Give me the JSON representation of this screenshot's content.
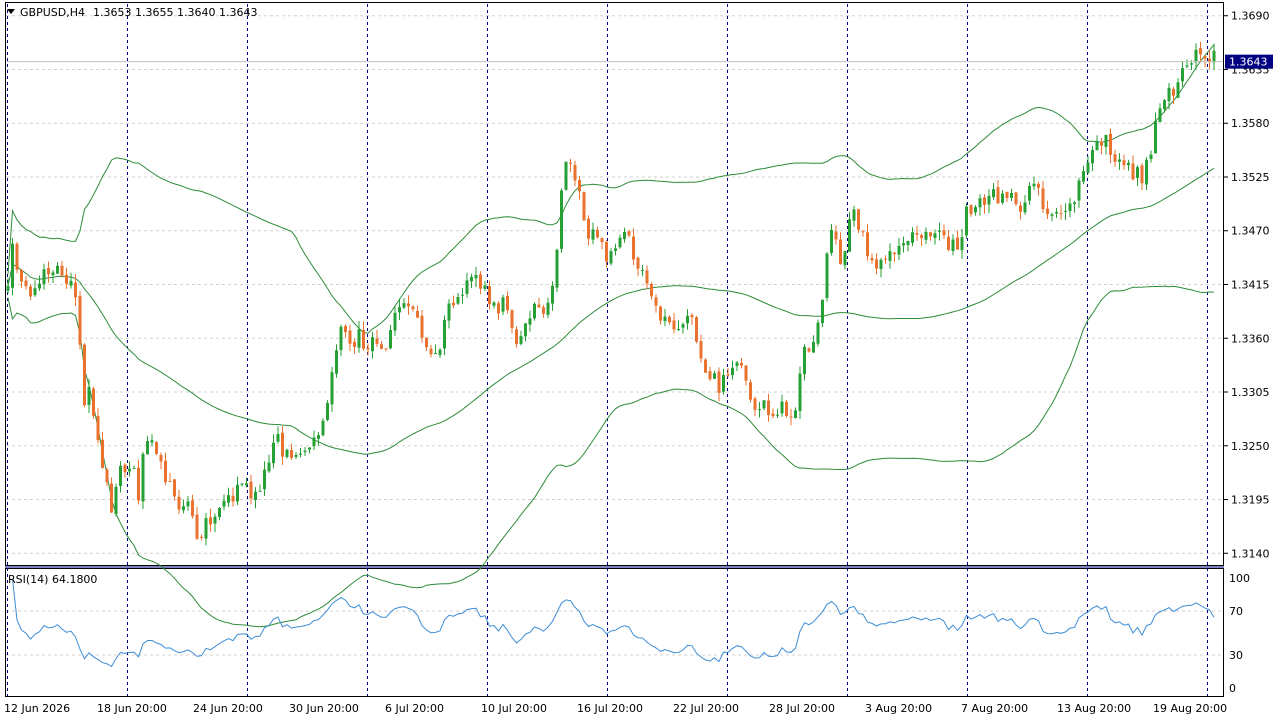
{
  "header": {
    "symbol": "GBPUSD,H4",
    "ohlc": "1.3653 1.3655 1.3640 1.3643"
  },
  "price_axis": {
    "labels": [
      "1.3690",
      "1.3635",
      "1.3580",
      "1.3525",
      "1.3470",
      "1.3415",
      "1.3360",
      "1.3305",
      "1.3250",
      "1.3195",
      "1.3140"
    ],
    "current_price": "1.3643"
  },
  "rsi": {
    "label": "RSI(14) 64.1800",
    "levels": [
      "100",
      "70",
      "30",
      "0"
    ]
  },
  "time_axis": {
    "labels": [
      "12 Jun 2026",
      "18 Jun 20:00",
      "24 Jun 20:00",
      "30 Jun 20:00",
      "6 Jul 20:00",
      "10 Jul 20:00",
      "16 Jul 20:00",
      "22 Jul 20:00",
      "28 Jul 20:00",
      "3 Aug 20:00",
      "7 Aug 20:00",
      "13 Aug 20:00",
      "19 Aug 20:00"
    ]
  },
  "colors": {
    "bull": "#26a035",
    "bear": "#e8722e",
    "bands": "#2e8b3a",
    "rsi": "#3c8dd6",
    "grid": "#d0d0d0",
    "separator": "#000080",
    "price_badge": "#000080"
  },
  "chart_data": {
    "type": "candlestick",
    "title": "GBPUSD,H4",
    "ylim": [
      1.3128,
      1.3702
    ],
    "price_ticks": [
      1.369,
      1.3635,
      1.358,
      1.3525,
      1.347,
      1.3415,
      1.336,
      1.3305,
      1.325,
      1.3195,
      1.314
    ],
    "current_price": 1.3643,
    "close_path": [
      [
        0,
        1.342
      ],
      [
        5,
        1.3455
      ],
      [
        10,
        1.3415
      ],
      [
        15,
        1.343
      ],
      [
        20,
        1.3415
      ],
      [
        25,
        1.3405
      ],
      [
        30,
        1.341
      ],
      [
        35,
        1.3425
      ],
      [
        40,
        1.342
      ],
      [
        45,
        1.343
      ],
      [
        50,
        1.344
      ],
      [
        55,
        1.3425
      ],
      [
        60,
        1.3405
      ],
      [
        65,
        1.3415
      ],
      [
        70,
        1.34
      ],
      [
        75,
        1.329
      ],
      [
        80,
        1.332
      ],
      [
        85,
        1.329
      ],
      [
        90,
        1.325
      ],
      [
        95,
        1.323
      ],
      [
        100,
        1.32
      ],
      [
        105,
        1.318
      ],
      [
        110,
        1.3215
      ],
      [
        115,
        1.323
      ],
      [
        120,
        1.322
      ],
      [
        125,
        1.3235
      ],
      [
        130,
        1.3195
      ],
      [
        135,
        1.3235
      ],
      [
        140,
        1.326
      ],
      [
        145,
        1.3245
      ],
      [
        150,
        1.323
      ],
      [
        155,
        1.3225
      ],
      [
        160,
        1.3215
      ],
      [
        165,
        1.3195
      ],
      [
        170,
        1.3185
      ],
      [
        175,
        1.3195
      ],
      [
        180,
        1.319
      ],
      [
        185,
        1.3175
      ],
      [
        190,
        1.3155
      ],
      [
        195,
        1.3165
      ],
      [
        200,
        1.317
      ],
      [
        205,
        1.3175
      ],
      [
        210,
        1.318
      ],
      [
        215,
        1.319
      ],
      [
        220,
        1.32
      ],
      [
        225,
        1.3195
      ],
      [
        230,
        1.321
      ],
      [
        235,
        1.3215
      ],
      [
        240,
        1.3205
      ],
      [
        245,
        1.32
      ],
      [
        250,
        1.3205
      ],
      [
        255,
        1.322
      ],
      [
        260,
        1.3235
      ],
      [
        265,
        1.325
      ],
      [
        270,
        1.3255
      ],
      [
        275,
        1.324
      ],
      [
        280,
        1.3245
      ],
      [
        285,
        1.3235
      ],
      [
        290,
        1.3255
      ],
      [
        295,
        1.324
      ],
      [
        300,
        1.325
      ],
      [
        305,
        1.3265
      ],
      [
        310,
        1.326
      ],
      [
        315,
        1.328
      ],
      [
        320,
        1.33
      ],
      [
        325,
        1.333
      ],
      [
        330,
        1.3365
      ],
      [
        335,
        1.337
      ],
      [
        340,
        1.336
      ],
      [
        345,
        1.335
      ],
      [
        350,
        1.3365
      ],
      [
        355,
        1.3355
      ],
      [
        360,
        1.335
      ],
      [
        365,
        1.336
      ],
      [
        370,
        1.3345
      ],
      [
        375,
        1.334
      ],
      [
        380,
        1.3355
      ],
      [
        385,
        1.3375
      ],
      [
        390,
        1.3395
      ],
      [
        395,
        1.34
      ],
      [
        400,
        1.3395
      ],
      [
        405,
        1.3385
      ],
      [
        410,
        1.338
      ],
      [
        415,
        1.336
      ],
      [
        420,
        1.335
      ],
      [
        425,
        1.3345
      ],
      [
        430,
        1.334
      ],
      [
        435,
        1.3375
      ],
      [
        440,
        1.339
      ],
      [
        445,
        1.34
      ],
      [
        450,
        1.341
      ],
      [
        455,
        1.3405
      ],
      [
        460,
        1.342
      ],
      [
        465,
        1.3425
      ],
      [
        470,
        1.342
      ],
      [
        475,
        1.3415
      ],
      [
        480,
        1.3405
      ],
      [
        485,
        1.3395
      ],
      [
        490,
        1.338
      ],
      [
        495,
        1.3395
      ],
      [
        500,
        1.3385
      ],
      [
        505,
        1.337
      ],
      [
        510,
        1.3355
      ],
      [
        515,
        1.336
      ],
      [
        520,
        1.3375
      ],
      [
        525,
        1.3395
      ],
      [
        530,
        1.34
      ],
      [
        535,
        1.339
      ],
      [
        540,
        1.34
      ],
      [
        545,
        1.341
      ],
      [
        550,
        1.347
      ],
      [
        555,
        1.353
      ],
      [
        560,
        1.354
      ],
      [
        565,
        1.353
      ],
      [
        570,
        1.3515
      ],
      [
        575,
        1.349
      ],
      [
        580,
        1.347
      ],
      [
        585,
        1.3465
      ],
      [
        590,
        1.346
      ],
      [
        595,
        1.345
      ],
      [
        600,
        1.344
      ],
      [
        605,
        1.3445
      ],
      [
        610,
        1.346
      ],
      [
        615,
        1.3475
      ],
      [
        620,
        1.3465
      ],
      [
        625,
        1.344
      ],
      [
        630,
        1.3425
      ],
      [
        635,
        1.343
      ],
      [
        640,
        1.341
      ],
      [
        645,
        1.339
      ],
      [
        650,
        1.3385
      ],
      [
        655,
        1.338
      ],
      [
        660,
        1.3375
      ],
      [
        665,
        1.337
      ],
      [
        670,
        1.3365
      ],
      [
        675,
        1.3375
      ],
      [
        680,
        1.338
      ],
      [
        685,
        1.3375
      ],
      [
        690,
        1.336
      ],
      [
        695,
        1.3335
      ],
      [
        700,
        1.332
      ],
      [
        705,
        1.3325
      ],
      [
        710,
        1.331
      ],
      [
        715,
        1.3315
      ],
      [
        720,
        1.332
      ],
      [
        725,
        1.333
      ],
      [
        730,
        1.3345
      ],
      [
        735,
        1.3335
      ],
      [
        740,
        1.331
      ],
      [
        745,
        1.3295
      ],
      [
        750,
        1.329
      ],
      [
        755,
        1.3295
      ],
      [
        760,
        1.3285
      ],
      [
        765,
        1.328
      ],
      [
        770,
        1.3285
      ],
      [
        775,
        1.329
      ],
      [
        780,
        1.328
      ],
      [
        785,
        1.3285
      ],
      [
        790,
        1.33
      ],
      [
        795,
        1.334
      ],
      [
        800,
        1.3355
      ],
      [
        805,
        1.335
      ],
      [
        810,
        1.337
      ],
      [
        815,
        1.34
      ],
      [
        820,
        1.346
      ],
      [
        825,
        1.3475
      ],
      [
        830,
        1.345
      ],
      [
        835,
        1.343
      ],
      [
        840,
        1.3475
      ],
      [
        845,
        1.349
      ],
      [
        850,
        1.3475
      ],
      [
        855,
        1.3465
      ],
      [
        860,
        1.345
      ],
      [
        865,
        1.343
      ],
      [
        870,
        1.3425
      ],
      [
        875,
        1.344
      ],
      [
        880,
        1.3445
      ],
      [
        885,
        1.345
      ],
      [
        890,
        1.3455
      ],
      [
        895,
        1.345
      ],
      [
        900,
        1.346
      ],
      [
        905,
        1.3465
      ],
      [
        910,
        1.347
      ],
      [
        915,
        1.3465
      ],
      [
        920,
        1.346
      ],
      [
        925,
        1.3465
      ],
      [
        930,
        1.347
      ],
      [
        935,
        1.346
      ],
      [
        940,
        1.3455
      ],
      [
        945,
        1.346
      ],
      [
        950,
        1.3455
      ],
      [
        955,
        1.347
      ],
      [
        960,
        1.35
      ],
      [
        965,
        1.349
      ],
      [
        970,
        1.3495
      ],
      [
        975,
        1.35
      ],
      [
        980,
        1.3505
      ],
      [
        985,
        1.351
      ],
      [
        990,
        1.3505
      ],
      [
        995,
        1.35
      ],
      [
        1000,
        1.35
      ],
      [
        1005,
        1.3505
      ],
      [
        1010,
        1.35
      ],
      [
        1015,
        1.3495
      ],
      [
        1020,
        1.3505
      ],
      [
        1025,
        1.352
      ],
      [
        1030,
        1.351
      ],
      [
        1035,
        1.3495
      ],
      [
        1040,
        1.349
      ],
      [
        1045,
        1.3495
      ],
      [
        1050,
        1.349
      ],
      [
        1055,
        1.3485
      ],
      [
        1060,
        1.349
      ],
      [
        1065,
        1.35
      ],
      [
        1070,
        1.3515
      ],
      [
        1075,
        1.353
      ],
      [
        1080,
        1.3545
      ],
      [
        1085,
        1.3555
      ],
      [
        1090,
        1.356
      ],
      [
        1095,
        1.3565
      ],
      [
        1100,
        1.356
      ],
      [
        1105,
        1.3545
      ],
      [
        1110,
        1.355
      ],
      [
        1115,
        1.354
      ],
      [
        1120,
        1.3535
      ],
      [
        1125,
        1.3525
      ],
      [
        1130,
        1.353
      ],
      [
        1135,
        1.3525
      ],
      [
        1140,
        1.354
      ],
      [
        1145,
        1.356
      ],
      [
        1150,
        1.3595
      ],
      [
        1155,
        1.36
      ],
      [
        1160,
        1.361
      ],
      [
        1165,
        1.3605
      ],
      [
        1170,
        1.362
      ],
      [
        1175,
        1.364
      ],
      [
        1180,
        1.3645
      ],
      [
        1185,
        1.365
      ],
      [
        1190,
        1.3655
      ],
      [
        1195,
        1.366
      ],
      [
        1200,
        1.3645
      ],
      [
        1205,
        1.3653
      ],
      [
        1210,
        1.3643
      ]
    ],
    "bollinger": {
      "period": 20,
      "deviations": 2
    },
    "rsi": {
      "period": 14,
      "last": 64.18,
      "levels": [
        70,
        30
      ],
      "ylim": [
        0,
        100
      ]
    },
    "x_tick_labels": [
      "12 Jun 2026",
      "18 Jun 20:00",
      "24 Jun 20:00",
      "30 Jun 20:00",
      "6 Jul 20:00",
      "10 Jul 20:00",
      "16 Jul 20:00",
      "22 Jul 20:00",
      "28 Jul 20:00",
      "3 Aug 20:00",
      "7 Aug 20:00",
      "13 Aug 20:00",
      "19 Aug 20:00"
    ]
  }
}
